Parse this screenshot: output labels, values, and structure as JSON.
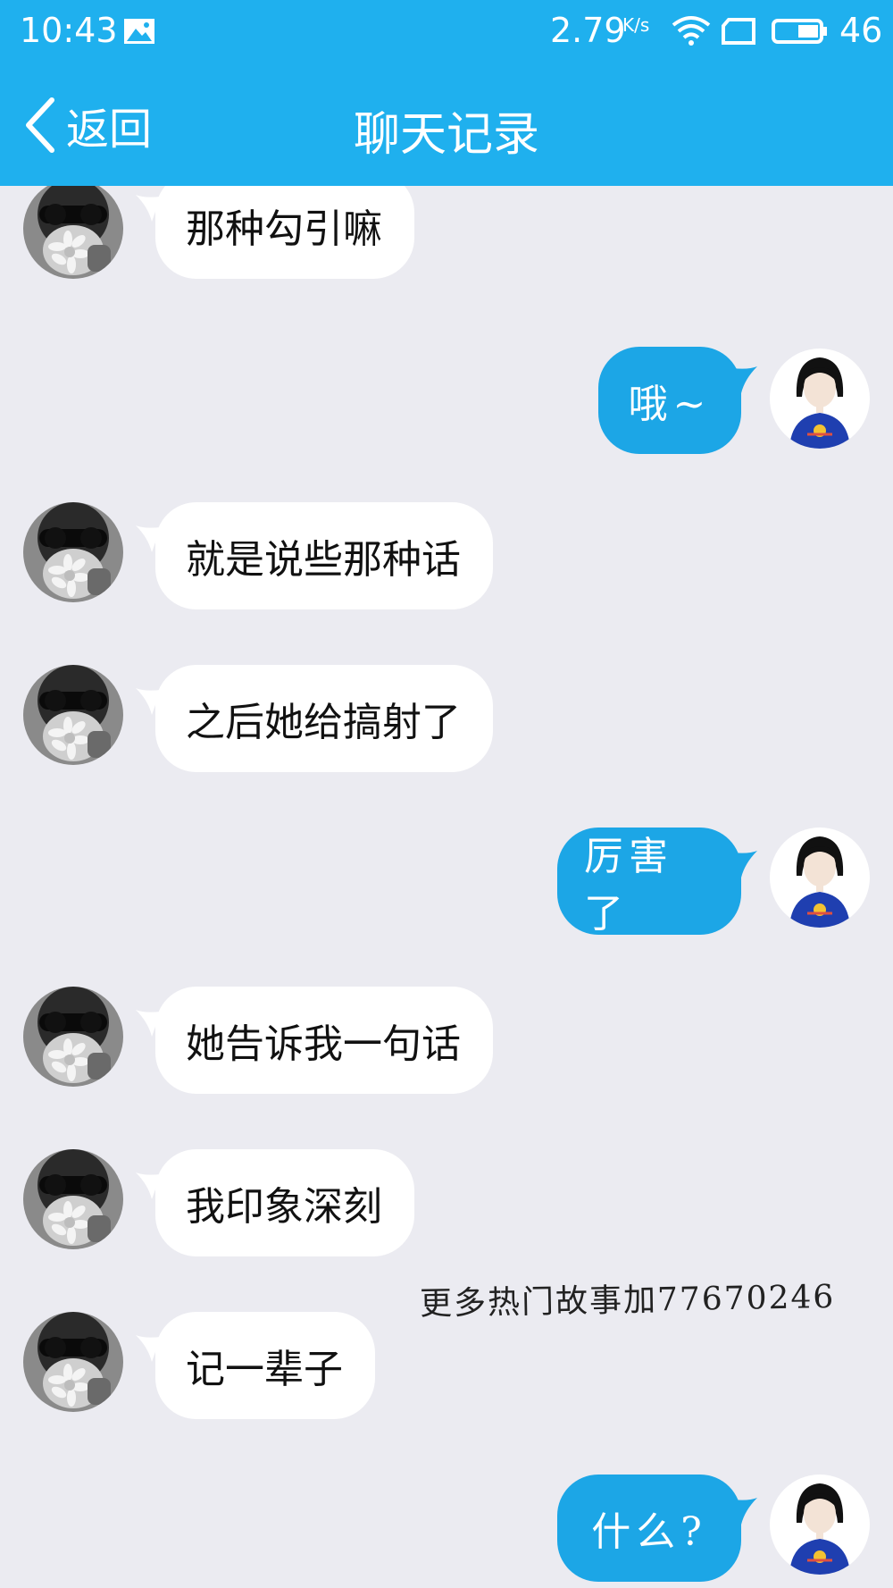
{
  "status_bar": {
    "time": "10:43",
    "net_speed": "2.79",
    "net_speed_unit": "K/s",
    "network_type": "46",
    "icons": [
      "image-icon",
      "wifi-icon",
      "sim-icon",
      "battery-icon"
    ]
  },
  "header": {
    "back_label": "返回",
    "title": "聊天记录"
  },
  "colors": {
    "header_bg": "#1fb0ee",
    "chat_bg": "#ebebf1",
    "incoming_bubble": "#ffffff",
    "outgoing_bubble": "#1ca6e6"
  },
  "messages": [
    {
      "side": "in",
      "text": "那种勾引嘛"
    },
    {
      "side": "out",
      "text": "哦~"
    },
    {
      "side": "in",
      "text": "就是说些那种话"
    },
    {
      "side": "in",
      "text": "之后她给搞射了"
    },
    {
      "side": "out",
      "text": "厉害了"
    },
    {
      "side": "in",
      "text": "她告诉我一句话"
    },
    {
      "side": "in",
      "text": "我印象深刻"
    },
    {
      "side": "in",
      "text": "记一辈子"
    },
    {
      "side": "out",
      "text": "什么?"
    }
  ],
  "watermark": "更多热门故事加77670246"
}
